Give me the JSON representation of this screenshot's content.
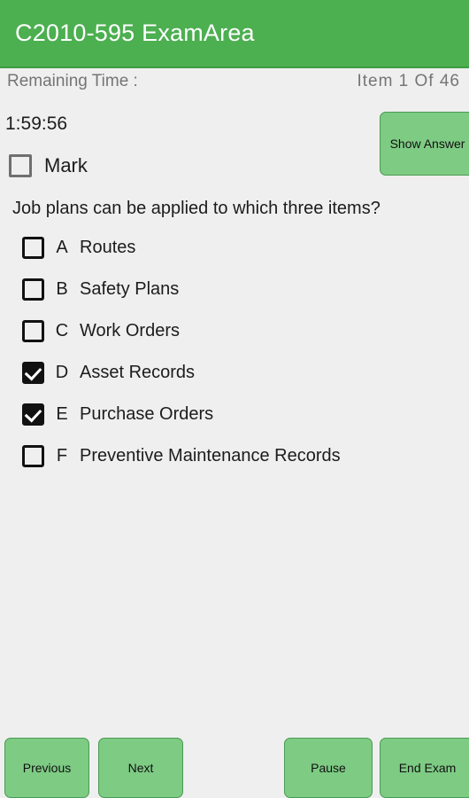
{
  "colors": {
    "appbar_green": "#4CAF50",
    "button_green": "#7ECB84",
    "button_border": "#4A9B53",
    "background": "#EFEFEF",
    "muted_text": "#757575",
    "body_text": "#1C1C1C"
  },
  "appbar": {
    "title": "C2010-595 ExamArea"
  },
  "info": {
    "remaining_time_label": "Remaining Time :",
    "item_count": "Item 1 Of 46"
  },
  "status": {
    "timer": "1:59:56",
    "mark_label": "Mark",
    "mark_checked": false,
    "show_answer_label": "Show Answer"
  },
  "question": {
    "text": "Job plans can be applied to which three items?",
    "options": [
      {
        "letter": "A",
        "text": "Routes",
        "checked": false
      },
      {
        "letter": "B",
        "text": "Safety Plans",
        "checked": false
      },
      {
        "letter": "C",
        "text": "Work Orders",
        "checked": false
      },
      {
        "letter": "D",
        "text": "Asset Records",
        "checked": true
      },
      {
        "letter": "E",
        "text": "Purchase Orders",
        "checked": true
      },
      {
        "letter": "F",
        "text": "Preventive Maintenance Records",
        "checked": false
      }
    ]
  },
  "buttons": {
    "previous": "Previous",
    "next": "Next",
    "pause": "Pause",
    "end_exam": "End Exam"
  }
}
